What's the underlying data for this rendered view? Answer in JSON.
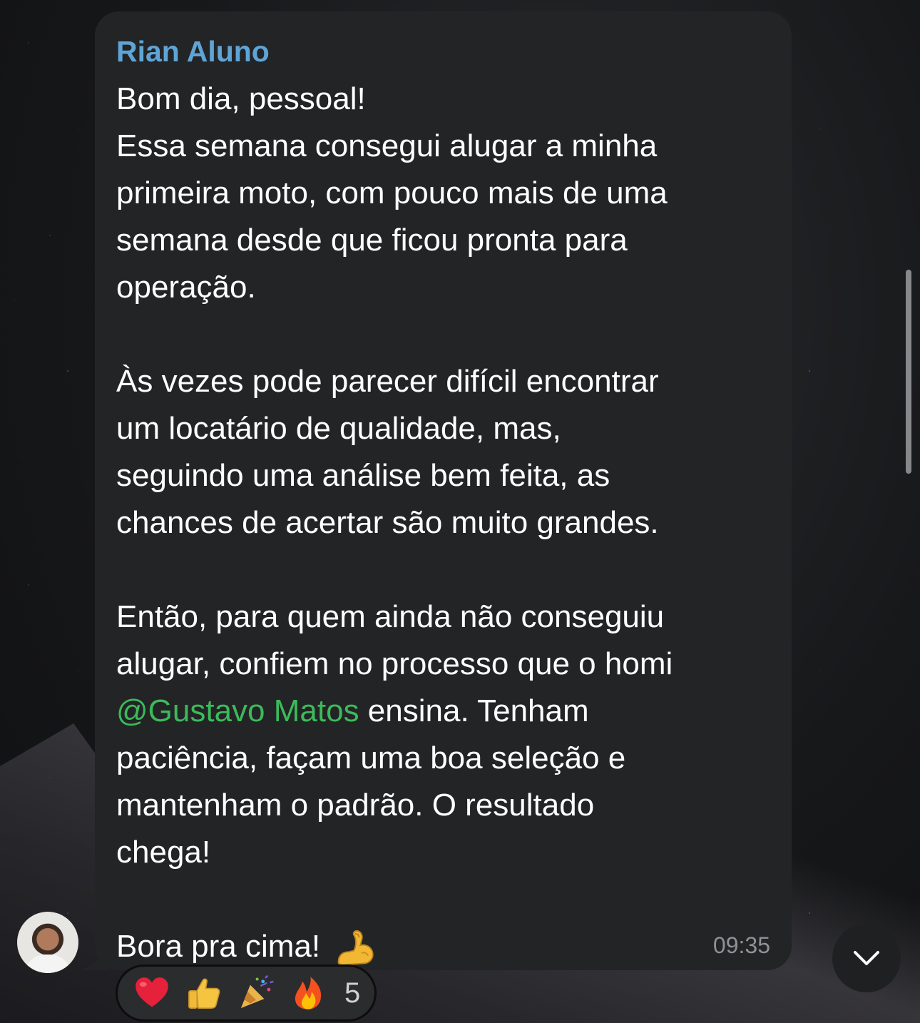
{
  "message": {
    "sender": "Rian Aluno",
    "paragraphs": [
      [
        "Bom dia, pessoal!",
        "Essa semana consegui alugar a minha",
        "primeira moto, com pouco mais de uma",
        "semana desde que ficou pronta para",
        "operação."
      ],
      [
        "Às vezes pode parecer difícil encontrar",
        "um locatário de qualidade, mas,",
        "seguindo uma análise bem feita, as",
        "chances de acertar são muito grandes."
      ]
    ],
    "p3_line1": "Então, para quem ainda não conseguiu",
    "p3_line2": "alugar, confiem no processo que o homi",
    "mention": "@Gustavo Matos",
    "p3_line3_rest": " ensina. Tenham",
    "p3_line4": "paciência, façam uma boa seleção e",
    "p3_line5": "mantenham o padrão. O resultado",
    "p3_line6": "chega!",
    "closing": "Bora pra cima!",
    "closing_emoji": "flexed-biceps",
    "time": "09:35"
  },
  "reactions": {
    "icons": [
      "red-heart",
      "thumbs-up",
      "party-popper",
      "fire"
    ],
    "count": "5"
  },
  "colors": {
    "sender": "#5fa4d6",
    "mention": "#3cba5b",
    "bubble": "#232425",
    "text": "#ffffff",
    "time": "#8f9194"
  },
  "icons": {
    "scroll_down": "chevron-down-icon"
  }
}
